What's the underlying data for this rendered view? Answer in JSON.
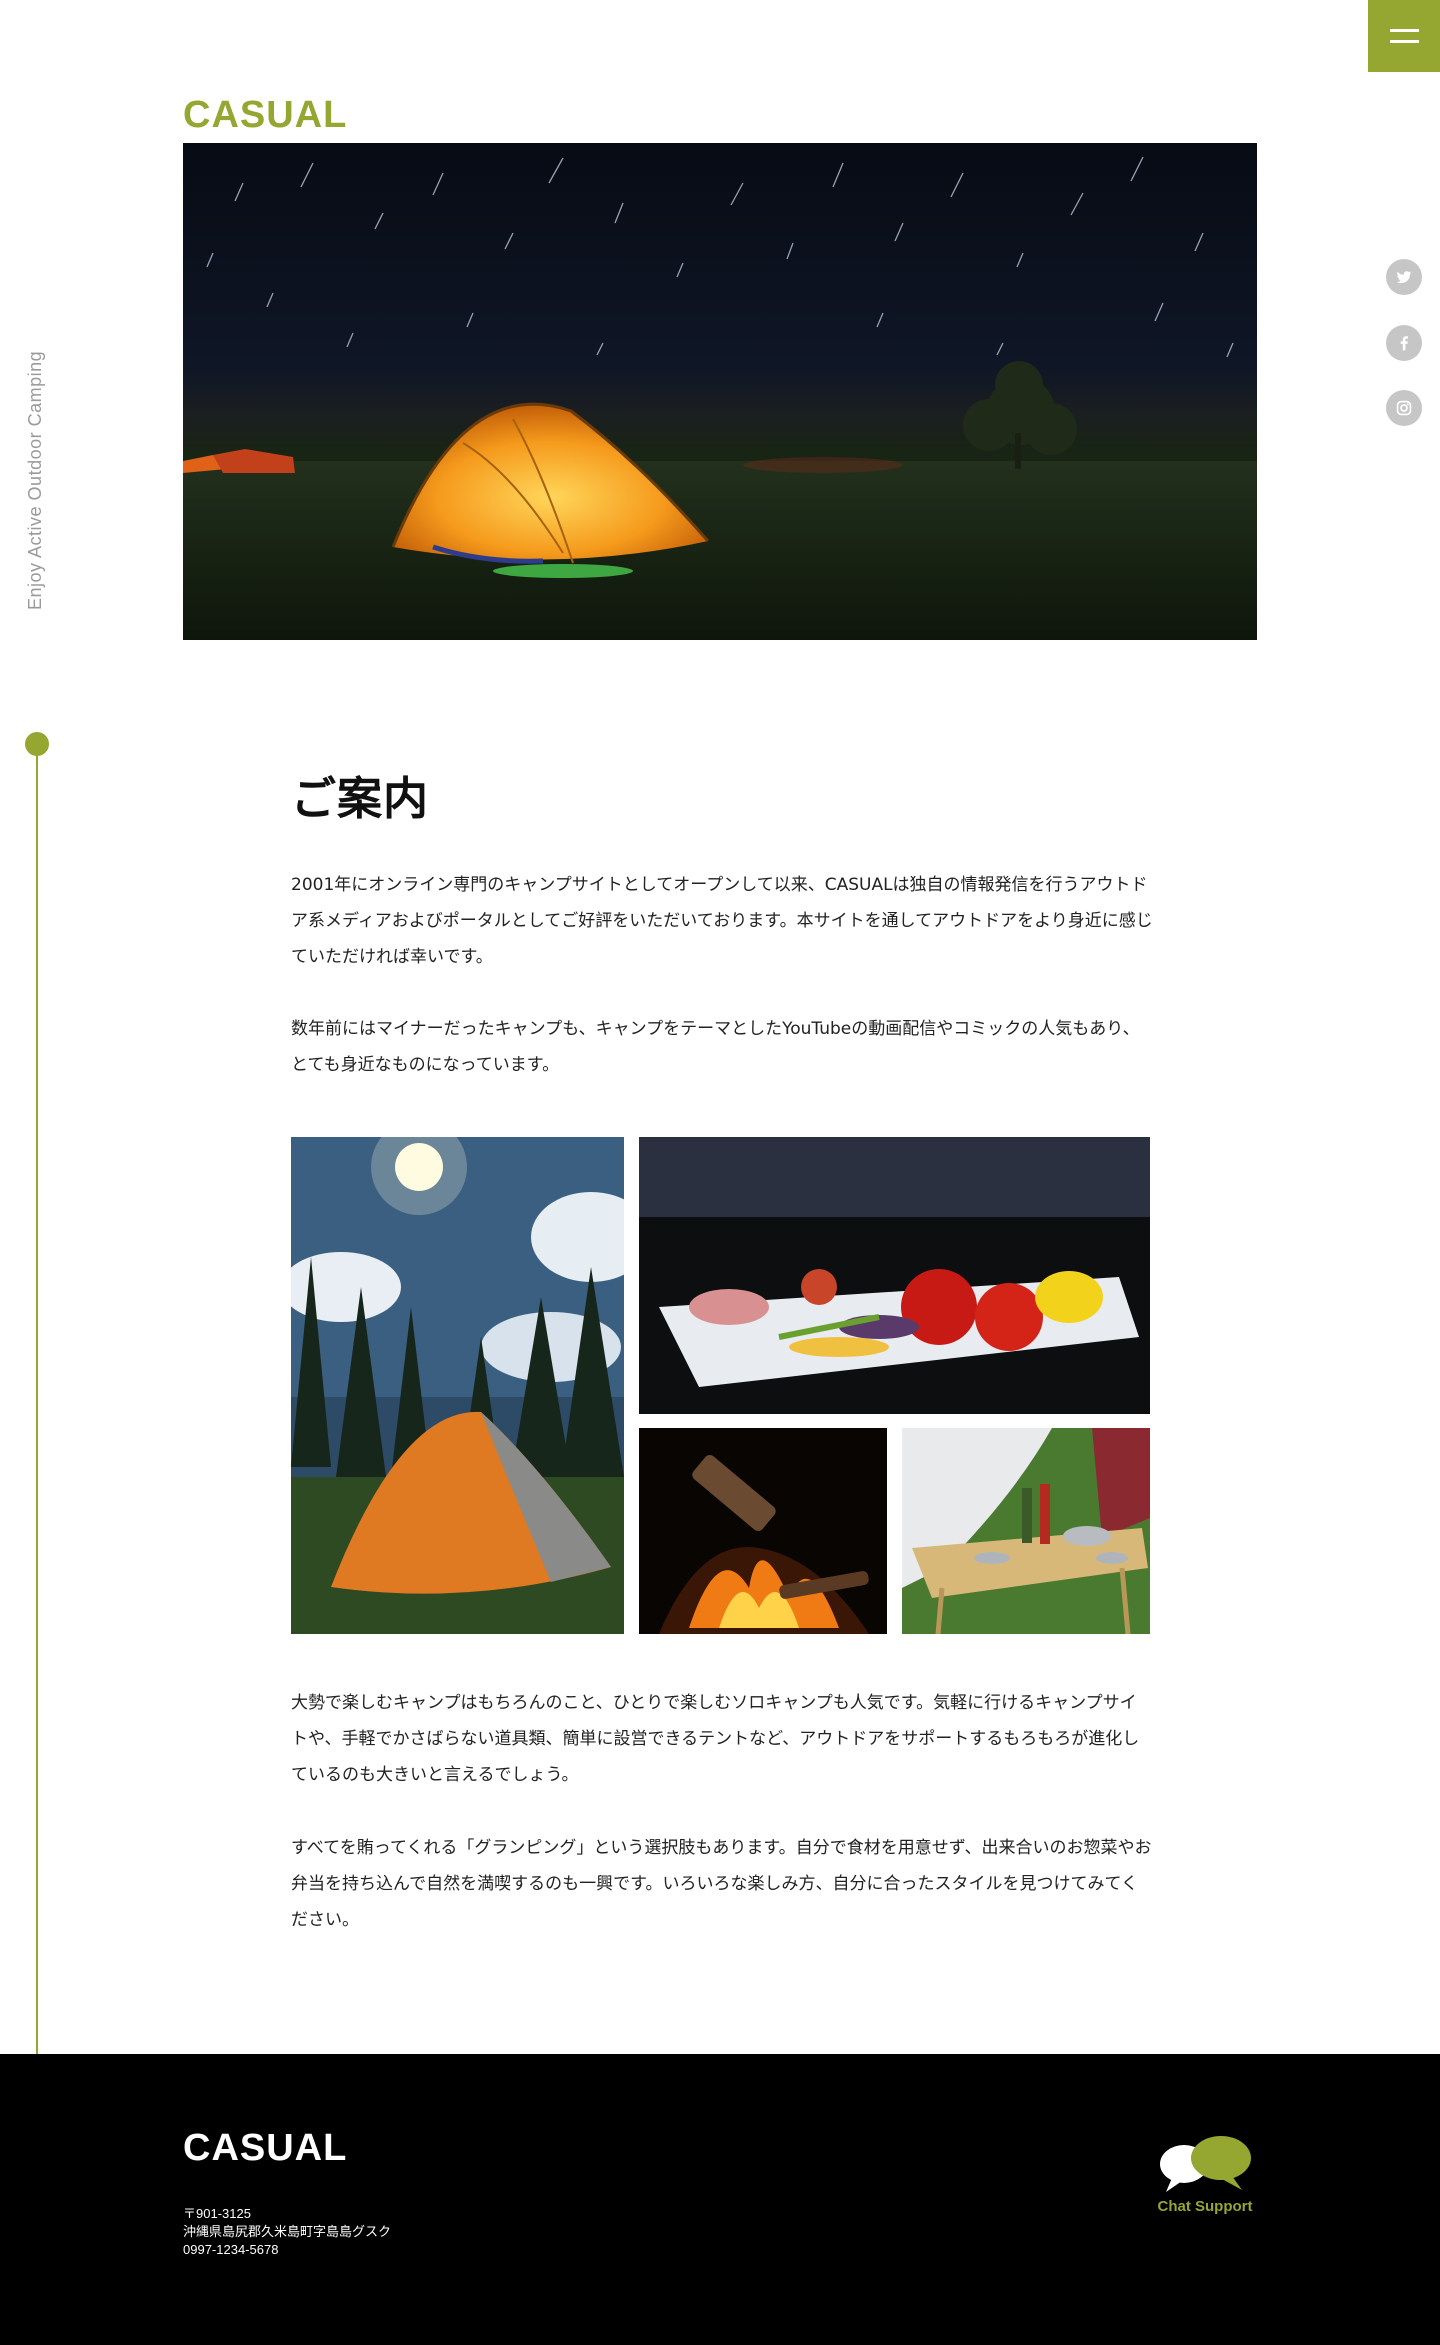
{
  "header": {
    "logo": "CASUAL",
    "menu_icon": "hamburger-icon"
  },
  "tagline": "Enjoy Active Outdoor Camping",
  "social": [
    {
      "name": "twitter",
      "icon": "twitter-icon"
    },
    {
      "name": "facebook",
      "icon": "facebook-icon"
    },
    {
      "name": "instagram",
      "icon": "instagram-icon"
    }
  ],
  "main": {
    "title": "ご案内",
    "paragraphs": [
      "2001年にオンライン専門のキャンプサイトとしてオープンして以来、CASUALは独自の情報発信を行うアウトドア系メディアおよびポータルとしてご好評をいただいております。本サイトを通してアウトドアをより身近に感じていただければ幸いです。",
      "数年前にはマイナーだったキャンプも、キャンプをテーマとしたYouTubeの動画配信やコミックの人気もあり、とても身近なものになっています。",
      "大勢で楽しむキャンプはもちろんのこと、ひとりで楽しむソロキャンプも人気です。気軽に行けるキャンプサイトや、手軽でかさばらない道具類、簡単に設営できるテントなど、アウトドアをサポートするもろもろが進化しているのも大きいと言えるでしょう。",
      "すべてを賄ってくれる「グランピング」という選択肢もあります。自分で食材を用意せず、出来合いのお惣菜やお弁当を持ち込んで自然を満喫するのも一興です。いろいろな楽しみ方、自分に合ったスタイルを見つけてみてください。"
    ]
  },
  "footer": {
    "logo": "CASUAL",
    "postal": "〒901-3125",
    "address": "沖縄県島尻郡久米島町字島島グスク",
    "phone": "0997-1234-5678",
    "chat_label": "Chat Support"
  },
  "colors": {
    "accent": "#95a631",
    "footer_bg": "#000000",
    "social_gray": "#c6c6c6"
  }
}
